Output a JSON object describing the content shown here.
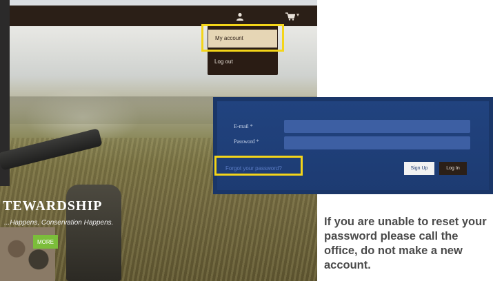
{
  "hero": {
    "title": "TEWARDSHIP",
    "subtitle": "...Happens, Conservation Happens.",
    "button_label": "MORE"
  },
  "topbar": {
    "user_icon": "user-icon",
    "cart_icon": "cart-icon",
    "cart_caret": "▾"
  },
  "account_menu": {
    "items": [
      {
        "label": "My account"
      },
      {
        "label": "Log out"
      }
    ]
  },
  "login": {
    "email_label": "E-mail *",
    "password_label": "Password *",
    "email_value": "",
    "password_value": "",
    "forgot_label": "Forgot your password?",
    "signup_label": "Sign Up",
    "login_label": "Log In"
  },
  "note": {
    "text": "If you are unable to reset your password please call the office, do not make a new account."
  },
  "colors": {
    "highlight": "#f4d519",
    "topbar": "#2b1f17",
    "panel": "#1f3f78",
    "hero_button": "#7bbd3a"
  }
}
